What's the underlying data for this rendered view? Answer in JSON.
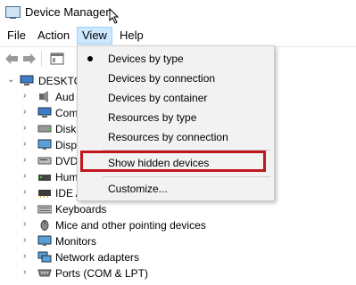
{
  "window": {
    "title": "Device Manager"
  },
  "menubar": {
    "items": [
      "File",
      "Action",
      "View",
      "Help"
    ]
  },
  "view_menu": {
    "items": [
      {
        "label": "Devices by type",
        "checked": true
      },
      {
        "label": "Devices by connection"
      },
      {
        "label": "Devices by container"
      },
      {
        "label": "Resources by type"
      },
      {
        "label": "Resources by connection"
      },
      {
        "label": "Show hidden devices"
      },
      {
        "label": "Customize..."
      }
    ]
  },
  "tree": {
    "root": "DESKTO",
    "children": [
      {
        "label": "Aud",
        "icon": "audio-icon"
      },
      {
        "label": "Com",
        "icon": "computer-icon"
      },
      {
        "label": "Disk",
        "icon": "disk-icon"
      },
      {
        "label": "Disp",
        "icon": "display-icon"
      },
      {
        "label": "DVD",
        "icon": "dvd-icon"
      },
      {
        "label": "Hum",
        "icon": "hid-icon"
      },
      {
        "label": "IDE A",
        "icon": "ide-icon"
      },
      {
        "label": "Keyboards",
        "icon": "keyboard-icon"
      },
      {
        "label": "Mice and other pointing devices",
        "icon": "mouse-icon"
      },
      {
        "label": "Monitors",
        "icon": "monitor-icon"
      },
      {
        "label": "Network adapters",
        "icon": "network-icon"
      },
      {
        "label": "Ports (COM & LPT)",
        "icon": "port-icon"
      }
    ]
  },
  "colors": {
    "highlight_border": "#c0161c",
    "menu_active": "#cce8ff"
  }
}
